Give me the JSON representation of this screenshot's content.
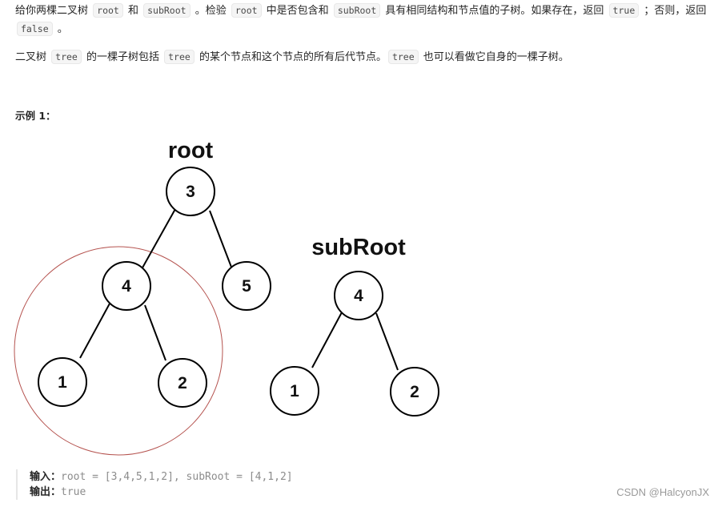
{
  "description": {
    "p1": [
      {
        "t": "text",
        "v": "给你两棵二叉树 "
      },
      {
        "t": "code",
        "v": "root"
      },
      {
        "t": "text",
        "v": " 和 "
      },
      {
        "t": "code",
        "v": "subRoot"
      },
      {
        "t": "text",
        "v": " 。检验 "
      },
      {
        "t": "code",
        "v": "root"
      },
      {
        "t": "text",
        "v": " 中是否包含和 "
      },
      {
        "t": "code",
        "v": "subRoot"
      },
      {
        "t": "text",
        "v": " 具有相同结构和节点值的子树。如果存在，返回 "
      },
      {
        "t": "code",
        "v": "true"
      },
      {
        "t": "text",
        "v": " ；否则，返回 "
      },
      {
        "t": "code",
        "v": "false"
      },
      {
        "t": "text",
        "v": " 。"
      }
    ],
    "p2": [
      {
        "t": "text",
        "v": "二叉树 "
      },
      {
        "t": "code",
        "v": "tree"
      },
      {
        "t": "text",
        "v": " 的一棵子树包括 "
      },
      {
        "t": "code",
        "v": "tree"
      },
      {
        "t": "text",
        "v": " 的某个节点和这个节点的所有后代节点。"
      },
      {
        "t": "code",
        "v": "tree"
      },
      {
        "t": "text",
        "v": " 也可以看做它自身的一棵子树。"
      }
    ]
  },
  "example": {
    "title": "示例 1：",
    "input_label": "输入：",
    "input_value": "root = [3,4,5,1,2], subRoot = [4,1,2]",
    "output_label": "输出：",
    "output_value": "true"
  },
  "diagram": {
    "root_title": "root",
    "subroot_title": "subRoot",
    "root_tree": {
      "n3": "3",
      "n4": "4",
      "n5": "5",
      "n1": "1",
      "n2": "2"
    },
    "sub_tree": {
      "n4": "4",
      "n1": "1",
      "n2": "2"
    },
    "highlight_color": "#b5534f"
  },
  "watermark": "CSDN @HalcyonJX"
}
